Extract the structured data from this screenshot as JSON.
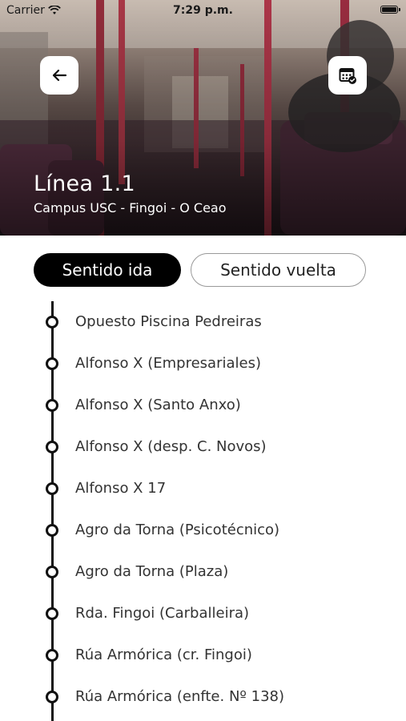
{
  "status_bar": {
    "carrier": "Carrier",
    "time": "7:29 p.m."
  },
  "header": {
    "title": "Línea 1.1",
    "subtitle": "Campus USC - Fingoi - O Ceao",
    "back_icon": "arrow-left-icon",
    "calendar_icon": "calendar-icon"
  },
  "tabs": {
    "ida_label": "Sentido ida",
    "vuelta_label": "Sentido vuelta",
    "selected": "ida"
  },
  "stops": [
    {
      "name": "Opuesto Piscina Pedreiras"
    },
    {
      "name": "Alfonso X (Empresariales)"
    },
    {
      "name": "Alfonso X (Santo Anxo)"
    },
    {
      "name": "Alfonso X (desp. C. Novos)"
    },
    {
      "name": "Alfonso X 17"
    },
    {
      "name": "Agro da Torna (Psicotécnico)"
    },
    {
      "name": "Agro da Torna (Plaza)"
    },
    {
      "name": "Rda. Fingoi (Carballeira)"
    },
    {
      "name": "Rúa Armórica (cr. Fingoi)"
    },
    {
      "name": "Rúa Armórica (enfte. Nº 138)"
    }
  ],
  "colors": {
    "active_tab": "#000000",
    "route_line": "#111111",
    "header_overlay": "#2a1c22"
  }
}
